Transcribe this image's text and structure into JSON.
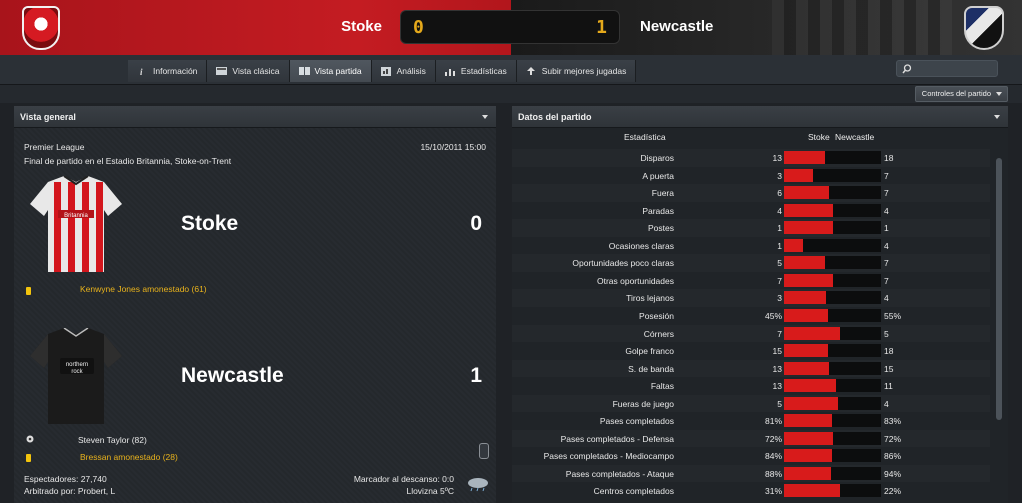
{
  "header": {
    "home_team": "Stoke",
    "away_team": "Newcastle",
    "home_score": "0",
    "away_score": "1"
  },
  "tabs": [
    {
      "label": "Información",
      "icon": "info-icon"
    },
    {
      "label": "Vista clásica",
      "icon": "classic-view-icon"
    },
    {
      "label": "Vista partida",
      "icon": "match-view-icon"
    },
    {
      "label": "Análisis",
      "icon": "analysis-icon"
    },
    {
      "label": "Estadísticas",
      "icon": "bar-chart-icon"
    },
    {
      "label": "Subir mejores jugadas",
      "icon": "upload-icon"
    }
  ],
  "active_tab": "Vista partida",
  "controls_button": "Controles del partido",
  "overview": {
    "title": "Vista general",
    "competition": "Premier League",
    "datetime": "15/10/2011 15:00",
    "venue": "Final de partido en el Estadio Britannia, Stoke-on-Trent",
    "home_team": "Stoke",
    "home_score": "0",
    "home_event": "Kenwyne Jones amonestado (61)",
    "away_team": "Newcastle",
    "away_score": "1",
    "away_goal": "Steven Taylor (82)",
    "away_event": "Bressan amonestado (28)",
    "spectators": "Espectadores: 27,740",
    "referee": "Arbitrado por: Probert, L",
    "halftime": "Marcador al descanso: 0:0",
    "weather": "Llovizna 5ºC"
  },
  "stats": {
    "title": "Datos del partido",
    "col_stat": "Estadística",
    "col_home": "Stoke",
    "col_away": "Newcastle",
    "rows": [
      {
        "label": "Disparos",
        "home": "13",
        "away": "18",
        "share": 0.42
      },
      {
        "label": "A puerta",
        "home": "3",
        "away": "7",
        "share": 0.3
      },
      {
        "label": "Fuera",
        "home": "6",
        "away": "7",
        "share": 0.46
      },
      {
        "label": "Paradas",
        "home": "4",
        "away": "4",
        "share": 0.5
      },
      {
        "label": "Postes",
        "home": "1",
        "away": "1",
        "share": 0.5
      },
      {
        "label": "Ocasiones claras",
        "home": "1",
        "away": "4",
        "share": 0.2
      },
      {
        "label": "Oportunidades poco claras",
        "home": "5",
        "away": "7",
        "share": 0.42
      },
      {
        "label": "Otras oportunidades",
        "home": "7",
        "away": "7",
        "share": 0.5
      },
      {
        "label": "Tiros lejanos",
        "home": "3",
        "away": "4",
        "share": 0.43
      },
      {
        "label": "Posesión",
        "home": "45%",
        "away": "55%",
        "share": 0.45
      },
      {
        "label": "Córners",
        "home": "7",
        "away": "5",
        "share": 0.58
      },
      {
        "label": "Golpe franco",
        "home": "15",
        "away": "18",
        "share": 0.45
      },
      {
        "label": "S. de banda",
        "home": "13",
        "away": "15",
        "share": 0.46
      },
      {
        "label": "Faltas",
        "home": "13",
        "away": "11",
        "share": 0.54
      },
      {
        "label": "Fueras de juego",
        "home": "5",
        "away": "4",
        "share": 0.56
      },
      {
        "label": "Pases completados",
        "home": "81%",
        "away": "83%",
        "share": 0.49
      },
      {
        "label": "Pases completados - Defensa",
        "home": "72%",
        "away": "72%",
        "share": 0.5
      },
      {
        "label": "Pases completados - Mediocampo",
        "home": "84%",
        "away": "86%",
        "share": 0.49
      },
      {
        "label": "Pases completados - Ataque",
        "home": "88%",
        "away": "94%",
        "share": 0.48
      },
      {
        "label": "Centros completados",
        "home": "31%",
        "away": "22%",
        "share": 0.58
      }
    ]
  },
  "colors": {
    "home_red": "#c41c22",
    "bar_red": "#d81b1b",
    "yellow_card": "#f3c40d",
    "score_amber": "#e5a91b"
  }
}
